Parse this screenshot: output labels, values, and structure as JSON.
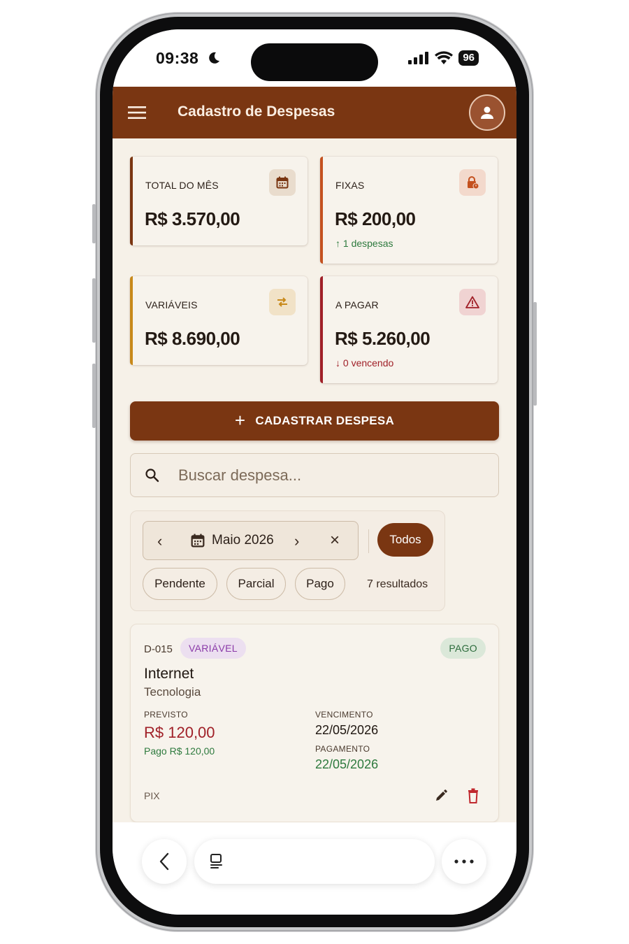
{
  "status_bar": {
    "time": "09:38",
    "battery": "96"
  },
  "app_bar": {
    "title": "Cadastro de Despesas"
  },
  "stats": [
    {
      "label": "TOTAL DO MÊS",
      "value": "R$ 3.570,00",
      "trend": "",
      "accent": "#7a3612",
      "icon": "calendar-icon"
    },
    {
      "label": "FIXAS",
      "value": "R$ 200,00",
      "trend": "↑ 1 despesas",
      "accent": "#c4511f",
      "icon": "lock-icon"
    },
    {
      "label": "VARIÁVEIS",
      "value": "R$ 8.690,00",
      "trend": "",
      "accent": "#c8891a",
      "icon": "swap-icon"
    },
    {
      "label": "A PAGAR",
      "value": "R$ 5.260,00",
      "trend": "↓ 0 vencendo",
      "accent": "#a02028",
      "icon": "warning-icon"
    }
  ],
  "actions": {
    "add_expense_label": "CADASTRAR DESPESA"
  },
  "search": {
    "placeholder": "Buscar despesa..."
  },
  "filters": {
    "month": "Maio 2026",
    "chips": [
      "Todos",
      "Pendente",
      "Parcial",
      "Pago"
    ],
    "selected": "Todos",
    "results": "7 resultados"
  },
  "expense": {
    "code": "D-015",
    "type": "VARIÁVEL",
    "status": "PAGO",
    "title": "Internet",
    "category": "Tecnologia",
    "planned_label": "PREVISTO",
    "planned_value": "R$ 120,00",
    "paid_text": "Pago R$ 120,00",
    "due_label": "VENCIMENTO",
    "due_date": "22/05/2026",
    "payment_label": "PAGAMENTO",
    "payment_date": "22/05/2026",
    "method": "PIX"
  },
  "colors": {
    "primary": "#7a3612",
    "background": "#f6f1e8",
    "danger": "#a02028",
    "success": "#2e7a3e",
    "purple": "#8a3aa8"
  }
}
